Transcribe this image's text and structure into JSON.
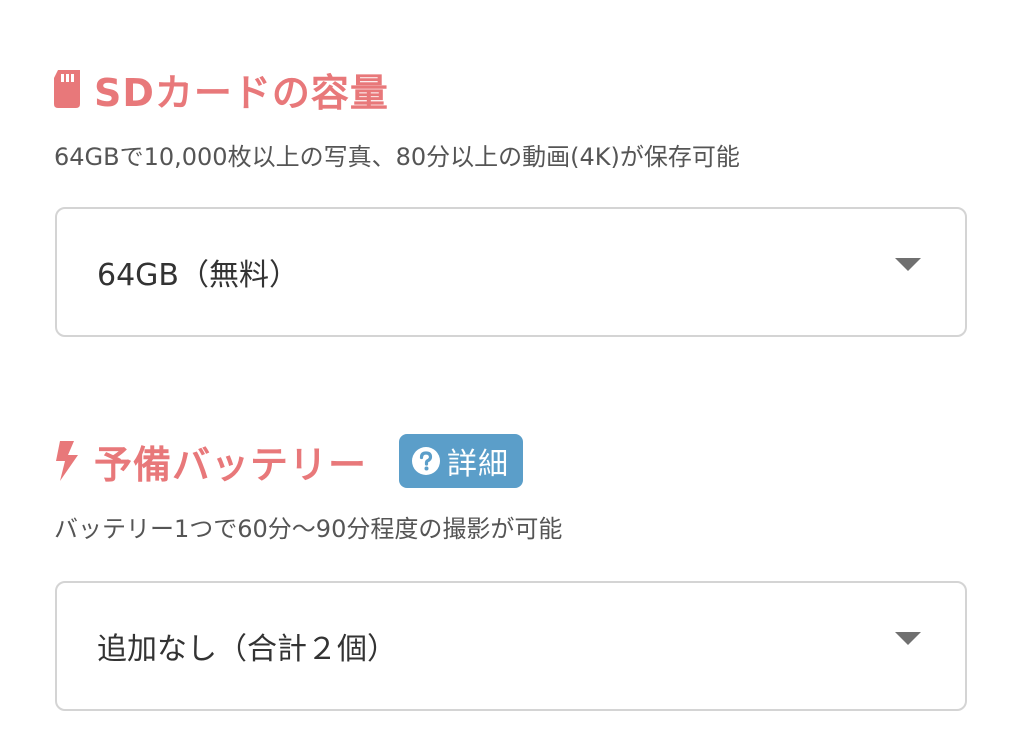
{
  "sd_section": {
    "icon": "sd-card-icon",
    "title": "SDカードの容量",
    "description": "64GBで10,000枚以上の写真、80分以上の動画(4K)が保存可能",
    "select": {
      "selected": "64GB（無料）"
    }
  },
  "battery_section": {
    "icon": "lightning-bolt-icon",
    "title": "予備バッテリー",
    "detail_badge": {
      "icon": "question-circle-icon",
      "label": "詳細"
    },
    "description": "バッテリー1つで60分〜90分程度の撮影が可能",
    "select": {
      "selected": "追加なし（合計２個）"
    }
  },
  "colors": {
    "accent": "#e8787a",
    "badge": "#5b9ec9",
    "text": "#555555",
    "border": "#d4d4d4"
  }
}
